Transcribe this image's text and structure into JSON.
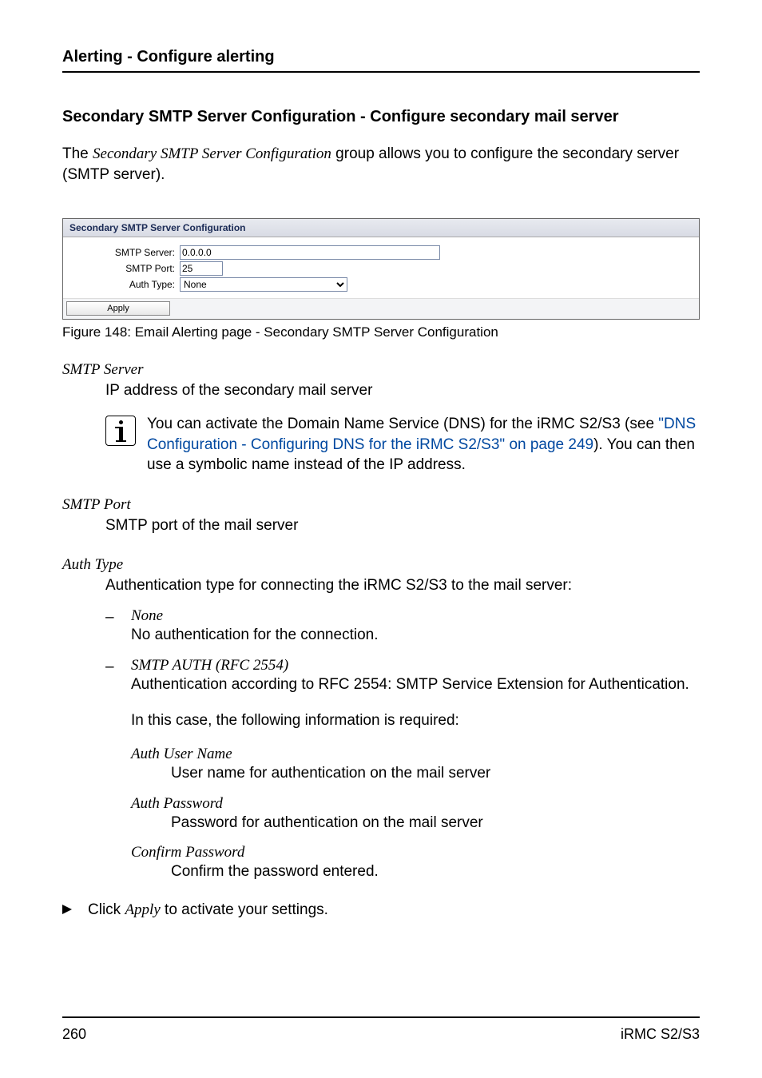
{
  "header": {
    "running": "Alerting - Configure alerting"
  },
  "section": {
    "title": "Secondary SMTP Server Configuration - Configure secondary mail server",
    "intro_pre": "The ",
    "intro_em": "Secondary SMTP Server Configuration",
    "intro_post": " group allows you to configure the secondary server (SMTP server)."
  },
  "figure": {
    "panel_title": "Secondary SMTP Server Configuration",
    "rows": {
      "server": {
        "label": "SMTP Server:",
        "value": "0.0.0.0"
      },
      "port": {
        "label": "SMTP Port:",
        "value": "25"
      },
      "auth": {
        "label": "Auth Type:",
        "value": "None"
      }
    },
    "apply": "Apply",
    "caption": "Figure 148: Email Alerting page - Secondary SMTP Server Configuration"
  },
  "defs": {
    "smtp_server": {
      "term": "SMTP Server",
      "desc": "IP address of the secondary mail server",
      "info_a": "You can activate the Domain Name Service (DNS) for the iRMC S2/S3 (see ",
      "info_link": "\"DNS Configuration - Configuring DNS for the iRMC S2/S3\" on page 249",
      "info_b": "). You can then use a symbolic name instead of the IP address."
    },
    "smtp_port": {
      "term": "SMTP Port",
      "desc": "SMTP port of the mail server"
    },
    "auth_type": {
      "term": "Auth Type",
      "desc": "Authentication type for connecting the iRMC S2/S3 to the mail server:",
      "items": {
        "none": {
          "term": "None",
          "desc": "No authentication for the connection."
        },
        "smtp_auth": {
          "term": "SMTP AUTH (RFC 2554)",
          "desc": "Authentication according to RFC 2554: SMTP Service Extension for Authentication.",
          "para": "In this case, the following information is required:",
          "fields": {
            "user": {
              "term": "Auth User Name",
              "desc": "User name for authentication on the mail server"
            },
            "pass": {
              "term": "Auth Password",
              "desc": "Password for authentication on the mail server"
            },
            "conf": {
              "term": "Confirm Password",
              "desc": "Confirm the password entered."
            }
          }
        }
      }
    }
  },
  "step": {
    "pre": "Click ",
    "em": "Apply",
    "post": " to activate your settings."
  },
  "footer": {
    "page": "260",
    "product": "iRMC S2/S3"
  }
}
